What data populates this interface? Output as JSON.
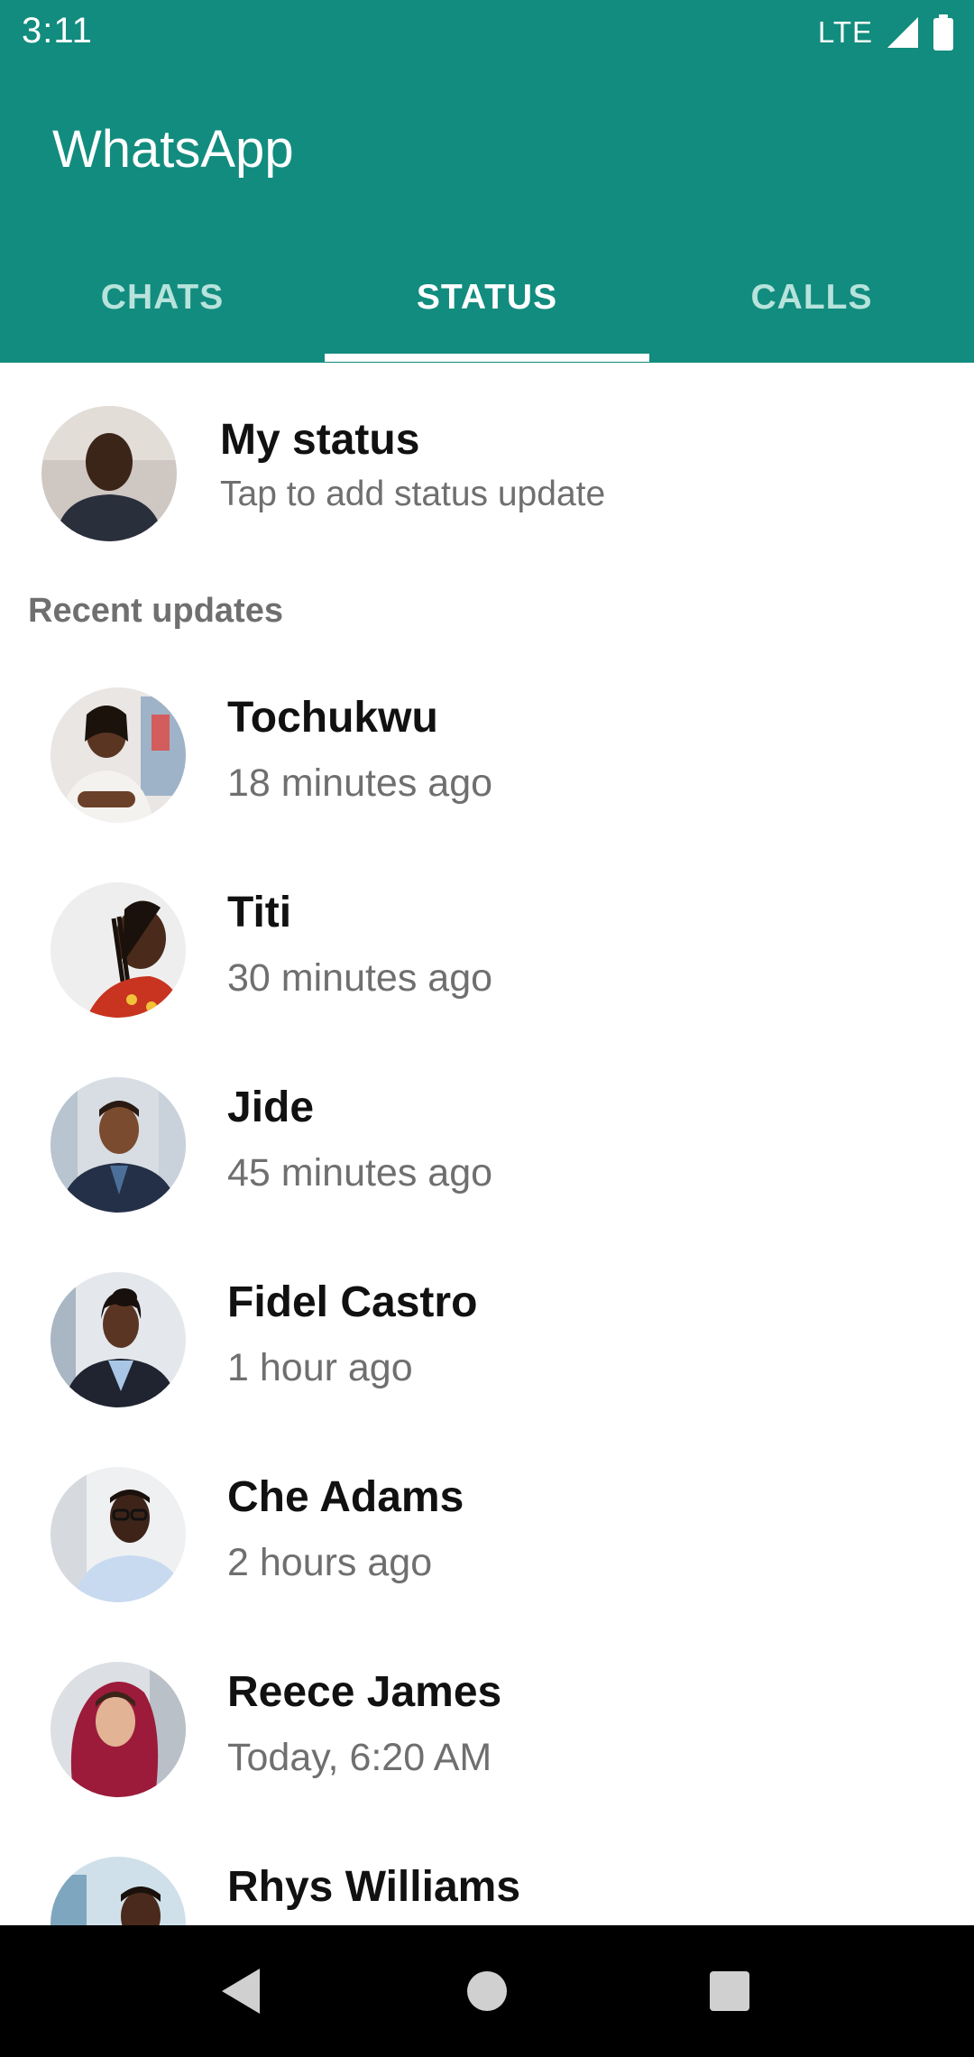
{
  "status_bar": {
    "time": "3:11",
    "network": "LTE",
    "icons": [
      "signal-icon",
      "battery-icon"
    ]
  },
  "app_bar": {
    "title": "WhatsApp",
    "color": "#128c7e",
    "tabs": [
      {
        "label": "CHATS",
        "active": false
      },
      {
        "label": "STATUS",
        "active": true
      },
      {
        "label": "CALLS",
        "active": false
      }
    ]
  },
  "my_status": {
    "title": "My status",
    "subtitle": "Tap to add status update"
  },
  "recent_header": "Recent updates",
  "updates": [
    {
      "name": "Tochukwu",
      "time": "18 minutes ago"
    },
    {
      "name": "Titi",
      "time": "30 minutes ago"
    },
    {
      "name": "Jide",
      "time": "45 minutes ago"
    },
    {
      "name": "Fidel Castro",
      "time": "1 hour ago"
    },
    {
      "name": "Che Adams",
      "time": "2 hours ago"
    },
    {
      "name": "Reece James",
      "time": "Today, 6:20 AM"
    },
    {
      "name": "Rhys Williams",
      "time": ""
    }
  ],
  "nav_bar": {
    "icons": [
      "back-icon",
      "home-icon",
      "recents-icon"
    ]
  }
}
